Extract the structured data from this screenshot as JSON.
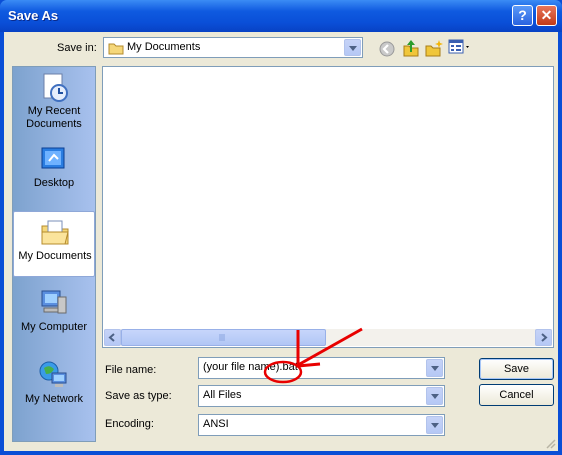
{
  "window": {
    "title": "Save As",
    "help_glyph": "?",
    "close_glyph": "✕"
  },
  "toolbar": {
    "save_in_label": "Save in:",
    "save_in_value": "My Documents"
  },
  "places": [
    {
      "label": "My Recent Documents",
      "icon": "recent-documents-icon"
    },
    {
      "label": "Desktop",
      "icon": "desktop-icon"
    },
    {
      "label": "My Documents",
      "icon": "my-documents-icon",
      "selected": true
    },
    {
      "label": "My Computer",
      "icon": "my-computer-icon"
    },
    {
      "label": "My Network",
      "icon": "my-network-icon"
    }
  ],
  "form": {
    "file_name_label": "File name:",
    "file_name_value": "(your file name).bat",
    "save_type_label": "Save as type:",
    "save_type_value": "All Files",
    "encoding_label": "Encoding:",
    "encoding_value": "ANSI"
  },
  "buttons": {
    "save": "Save",
    "cancel": "Cancel"
  },
  "colors": {
    "title_bar": "#0a4ed6",
    "dialog_bg": "#ece9d8",
    "annotation": "#e80000"
  }
}
